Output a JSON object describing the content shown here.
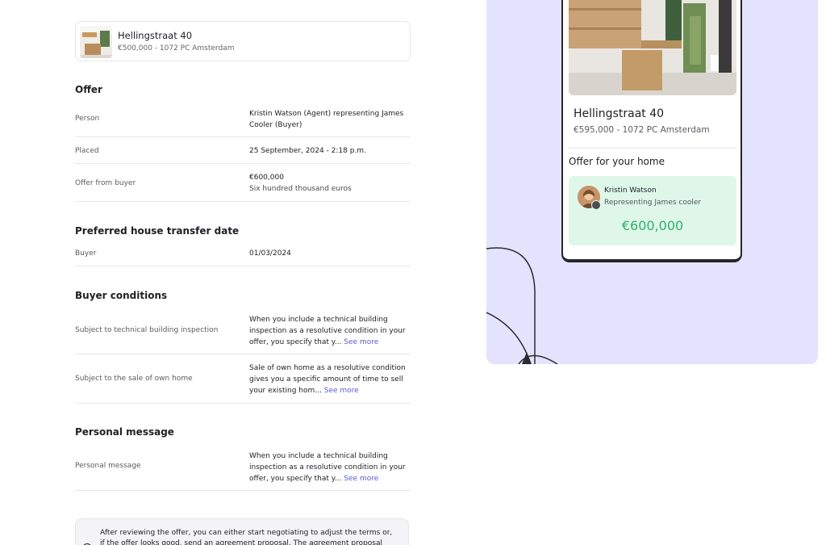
{
  "property": {
    "title": "Hellingstraat 40",
    "subtitle": "€500,000 - 1072 PC Amsterdam"
  },
  "offer": {
    "heading": "Offer",
    "person_label": "Person",
    "person_value": "Kristin Watson (Agent) representing James Cooler (Buyer)",
    "placed_label": "Placed",
    "placed_value": "25 September, 2024 - 2:18 p.m.",
    "amount_label": "Offer from buyer",
    "amount_value": "€600,000",
    "amount_words": "Six hundred thousand euros"
  },
  "transfer": {
    "heading": "Preferred house transfer date",
    "buyer_label": "Buyer",
    "buyer_value": "01/03/2024"
  },
  "conditions": {
    "heading": "Buyer conditions",
    "items": [
      {
        "label": "Subject to technical building inspection",
        "text": "When you include a technical building inspection as a resolutive condition in your offer, you specify that y...",
        "link": "See more"
      },
      {
        "label": "Subject to the sale of own home",
        "text": "Sale of own home as a resolutive condition gives you a specific amount of time to sell your existing hom...",
        "link": "See more"
      }
    ]
  },
  "message": {
    "heading": "Personal message",
    "label": "Personal message",
    "text": "When you include a technical building inspection as a resolutive condition in your offer, you specify that y...",
    "link": "See more"
  },
  "note": {
    "text": "After reviewing the offer, you can either start negotiating to adjust the terms or, if the offer looks good, send an agreement proposal. The agreement proposal"
  },
  "preview": {
    "title": "Hellingstraat 40",
    "subtitle": "€595,000 - 1072 PC Amsterdam",
    "offer_label": "Offer for your home",
    "agent_name": "Kristin Watson",
    "agent_sub": "Representing James cooler",
    "amount": "€600,000"
  },
  "colors": {
    "panel_bg": "#e5e2fd",
    "offer_card_bg": "#def7e9",
    "offer_amount": "#2fae6b",
    "link": "#5a5ad6"
  },
  "icons": [
    "property-thumbnail",
    "kitchen-photo",
    "agent-avatar",
    "info-icon"
  ]
}
